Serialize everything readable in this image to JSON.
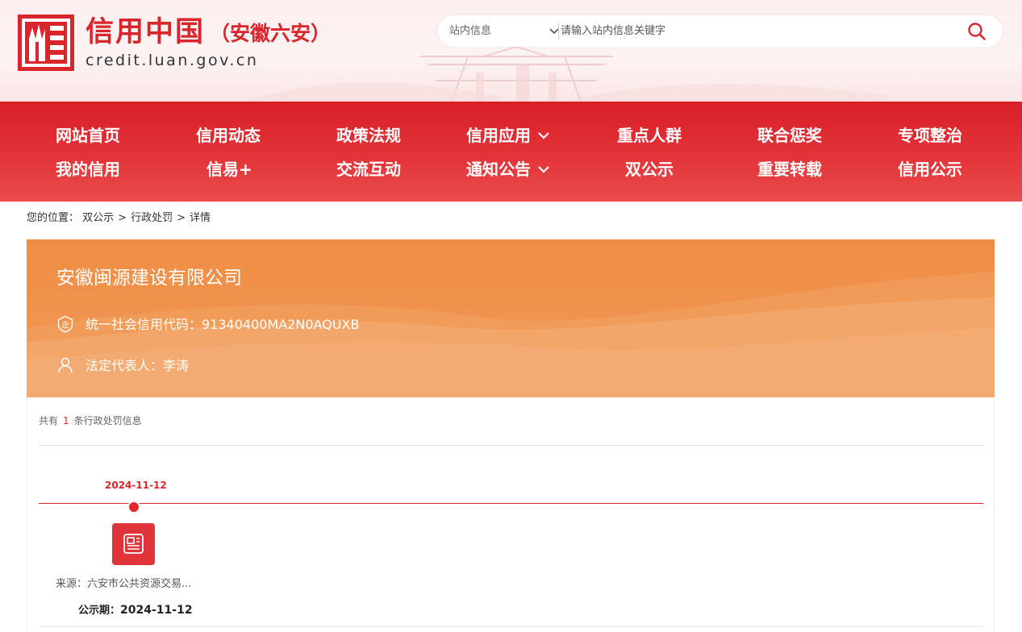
{
  "header": {
    "site_title": "信用中国",
    "site_subtitle": "（安徽六安）",
    "domain": "credit.luan.gov.cn",
    "search": {
      "scope_selected": "站内信息",
      "placeholder": "请输入站内信息关键字"
    }
  },
  "nav": {
    "row1": [
      "网站首页",
      "信用动态",
      "政策法规",
      "信用应用",
      "重点人群",
      "联合惩奖",
      "专项整治"
    ],
    "row2": [
      "我的信用",
      "信易+",
      "交流互动",
      "通知公告",
      "双公示",
      "重要转载",
      "信用公示"
    ]
  },
  "breadcrumb": {
    "prefix": "您的位置：",
    "items": [
      "双公示",
      "行政处罚",
      "详情"
    ],
    "separator": ">"
  },
  "entity": {
    "name": "安徽闽源建设有限公司",
    "credit_code_label": "统一社会信用代码：",
    "credit_code": "91340400MA2N0AQUXB",
    "legal_rep_label": "法定代表人：",
    "legal_rep": "李涛"
  },
  "records": {
    "count_prefix": "共有",
    "count": "1",
    "count_suffix": "条行政处罚信息",
    "items": [
      {
        "date": "2024-11-12",
        "source": "来源：六安市公共资源交易...",
        "publish_label": "公示期：",
        "publish_date": "2024-11-12"
      }
    ]
  },
  "colors": {
    "brand_red": "#d8262c",
    "banner_orange": "#ef8d45"
  }
}
